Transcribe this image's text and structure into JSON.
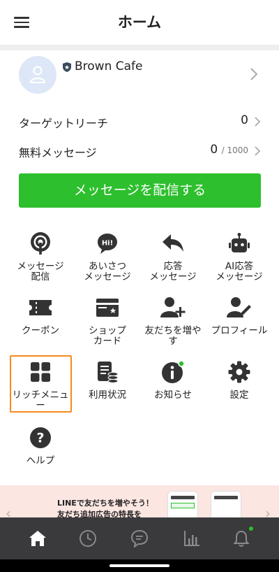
{
  "header": {
    "title": "ホーム",
    "menu_icon": "hamburger-icon"
  },
  "profile": {
    "name": "Brown Cafe",
    "badge_icon": "shield-icon",
    "avatar_icon": "user-icon"
  },
  "stats": {
    "target_reach": {
      "label": "ターゲットリーチ",
      "value": "0"
    },
    "free_messages": {
      "label": "無料メッセージ",
      "value": "0",
      "limit": "/ 1000"
    }
  },
  "broadcast_button": "メッセージを配信する",
  "menu": [
    {
      "id": "broadcast",
      "label": "メッセージ\n配信",
      "icon": "broadcast-icon"
    },
    {
      "id": "greeting",
      "label": "あいさつ\nメッセージ",
      "icon": "greeting-icon"
    },
    {
      "id": "auto-reply",
      "label": "応答\nメッセージ",
      "icon": "reply-icon"
    },
    {
      "id": "ai-reply",
      "label": "AI応答\nメッセージ",
      "icon": "robot-icon"
    },
    {
      "id": "coupon",
      "label": "クーポン",
      "icon": "coupon-icon"
    },
    {
      "id": "shop-card",
      "label": "ショップ\nカード",
      "icon": "shop-card-icon"
    },
    {
      "id": "add-friends",
      "label": "友だちを増や\nす",
      "icon": "add-friend-icon"
    },
    {
      "id": "profile",
      "label": "プロフィール",
      "icon": "profile-edit-icon"
    },
    {
      "id": "rich-menu",
      "label": "リッチメニュ\nー",
      "icon": "rich-menu-icon"
    },
    {
      "id": "usage",
      "label": "利用状況",
      "icon": "usage-icon"
    },
    {
      "id": "news",
      "label": "お知らせ",
      "icon": "info-icon"
    },
    {
      "id": "settings",
      "label": "設定",
      "icon": "gear-icon"
    },
    {
      "id": "help",
      "label": "ヘルプ",
      "icon": "help-icon"
    }
  ],
  "banner": {
    "line1": "LINEで友だちを増やそう！",
    "line2": "友だち追加広告の特長を"
  },
  "tabbar": [
    {
      "id": "home",
      "icon": "home-icon",
      "active": true
    },
    {
      "id": "history",
      "icon": "clock-icon",
      "active": false
    },
    {
      "id": "chat",
      "icon": "chat-icon",
      "active": false
    },
    {
      "id": "analytics",
      "icon": "chart-icon",
      "active": false
    },
    {
      "id": "notifications",
      "icon": "bell-icon",
      "active": false,
      "badge": true
    }
  ],
  "colors": {
    "accent": "#2dbf2d",
    "highlight": "#f58a1f",
    "tabbar": "#3a3a3c",
    "banner": "#fbe6e2"
  }
}
